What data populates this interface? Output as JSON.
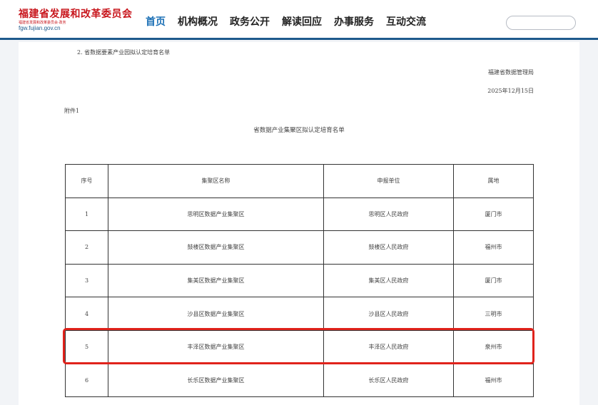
{
  "header": {
    "logo_title": "福建省发展和改革委员会",
    "logo_subtitle": "福建省发展和改革委员会·政务",
    "logo_url": "fgw.fujian.gov.cn",
    "nav": [
      "首页",
      "机构概况",
      "政务公开",
      "解读回应",
      "办事服务",
      "互动交流"
    ],
    "active_nav": "首页",
    "search_placeholder": ""
  },
  "document": {
    "item_line": "2. 省数据要素产业园拟认定培育名单",
    "issuer": "福建省数据管理局",
    "date": "2025年12月15日",
    "annex_label": "附件1",
    "list_title": "省数据产业集聚区拟认定培育名单"
  },
  "table": {
    "columns": [
      "序号",
      "集聚区名称",
      "申报单位",
      "属地"
    ],
    "rows": [
      [
        "1",
        "思明区数据产业集聚区",
        "思明区人民政府",
        "厦门市"
      ],
      [
        "2",
        "鼓楼区数据产业集聚区",
        "鼓楼区人民政府",
        "福州市"
      ],
      [
        "3",
        "集美区数据产业集聚区",
        "集美区人民政府",
        "厦门市"
      ],
      [
        "4",
        "沙县区数据产业集聚区",
        "沙县区人民政府",
        "三明市"
      ],
      [
        "5",
        "丰泽区数据产业集聚区",
        "丰泽区人民政府",
        "泉州市"
      ],
      [
        "6",
        "长乐区数据产业集聚区",
        "长乐区人民政府",
        "福州市"
      ]
    ],
    "highlighted_row": "5"
  },
  "colors": {
    "brand_red": "#c8161d",
    "nav_blue": "#1a6fb5",
    "header_rule": "#1e5a8c",
    "highlight_red": "#e0231c"
  }
}
